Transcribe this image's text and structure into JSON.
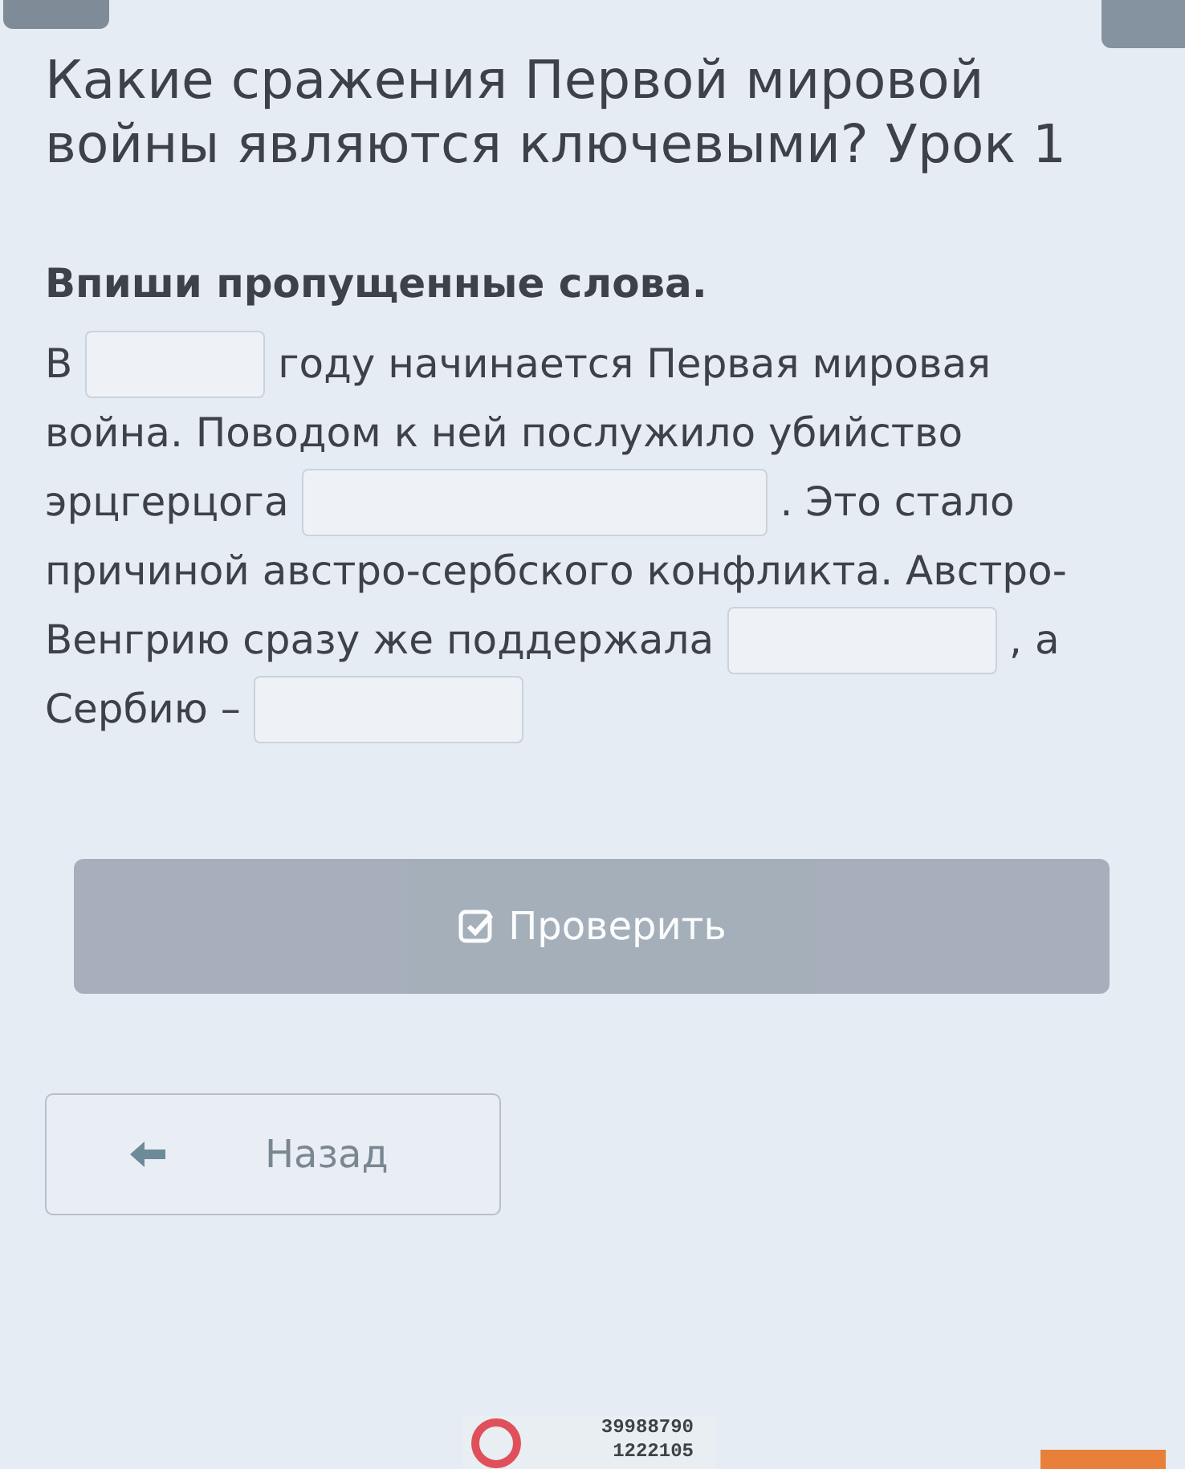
{
  "title": "Какие сражения Первой мировой войны являются ключевыми? Урок 1",
  "task": {
    "instruction": "Впиши пропущенные слова.",
    "lines": [
      [
        {
          "kind": "text",
          "text": "В"
        },
        {
          "kind": "blank"
        },
        {
          "kind": "text",
          "text": "году начинается Первая мировая"
        }
      ],
      [
        {
          "kind": "text",
          "text": "война. Поводом к ней послужило убийство"
        }
      ],
      [
        {
          "kind": "text",
          "text": "эрцгерцога"
        },
        {
          "kind": "blank"
        },
        {
          "kind": "text",
          "text": ". Это стало"
        }
      ],
      [
        {
          "kind": "text",
          "text": "причиной австро-сербского конфликта. Австро-"
        }
      ],
      [
        {
          "kind": "text",
          "text": "Венгрию сразу же поддержала"
        },
        {
          "kind": "blank"
        },
        {
          "kind": "text",
          "text": ", а"
        }
      ],
      [
        {
          "kind": "text",
          "text": "Сербию –"
        },
        {
          "kind": "blank"
        }
      ]
    ]
  },
  "check_button": {
    "label": "Проверить",
    "disabled": true
  },
  "back_button": {
    "label": "Назад"
  },
  "sticker": {
    "lines": [
      "39988790",
      "1222105"
    ]
  }
}
